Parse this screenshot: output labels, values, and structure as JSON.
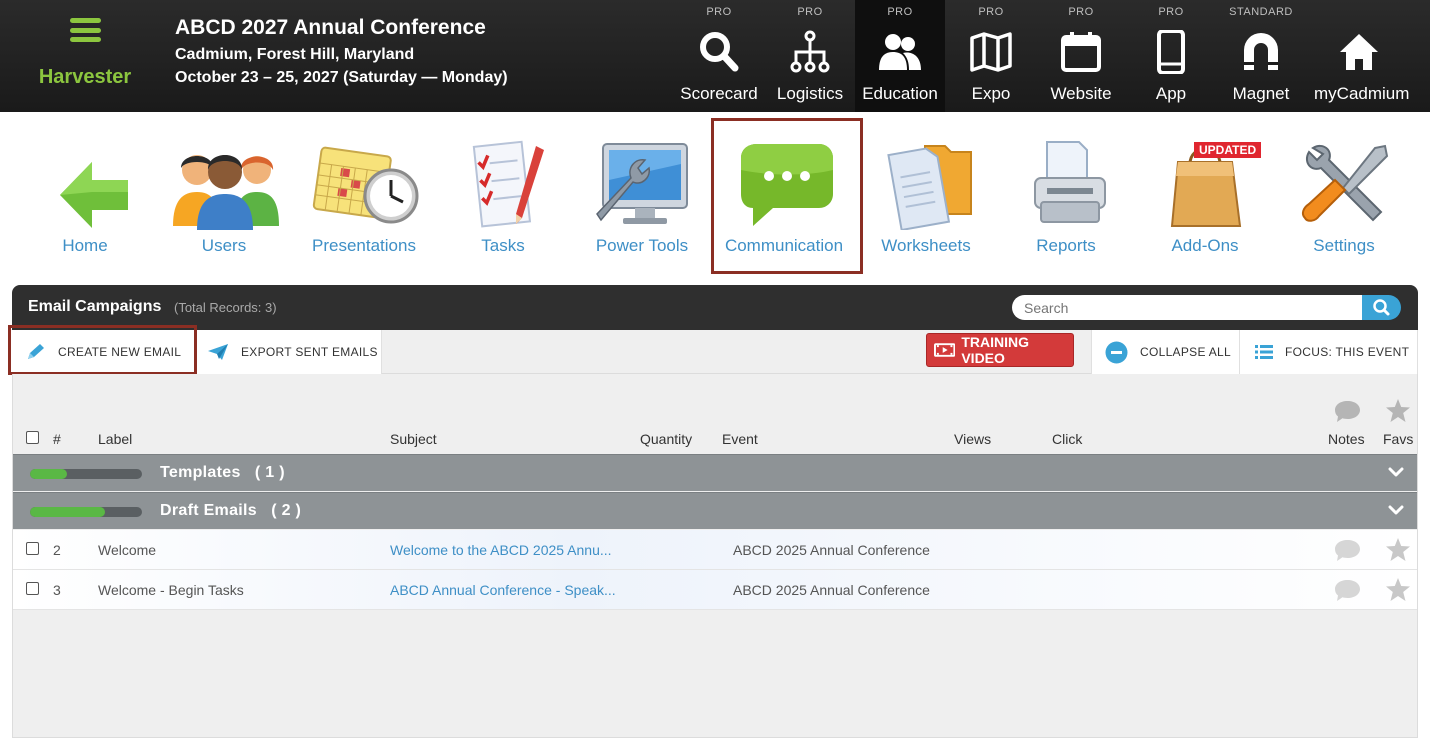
{
  "brand": {
    "name": "Harvester"
  },
  "event": {
    "title": "ABCD 2027 Annual Conference",
    "location": "Cadmium, Forest Hill, Maryland",
    "dates": "October 23 – 25, 2027 (Saturday — Monday)"
  },
  "topnav": [
    {
      "tier": "PRO",
      "label": "Scorecard",
      "icon": "search-icon"
    },
    {
      "tier": "PRO",
      "label": "Logistics",
      "icon": "org-chart-icon"
    },
    {
      "tier": "PRO",
      "label": "Education",
      "icon": "users-icon",
      "active": true
    },
    {
      "tier": "PRO",
      "label": "Expo",
      "icon": "map-icon"
    },
    {
      "tier": "PRO",
      "label": "Website",
      "icon": "calendar-icon"
    },
    {
      "tier": "PRO",
      "label": "App",
      "icon": "phone-icon"
    },
    {
      "tier": "STANDARD",
      "label": "Magnet",
      "icon": "magnet-icon"
    },
    {
      "tier": "",
      "label": "myCadmium",
      "icon": "home-icon"
    }
  ],
  "modules": [
    {
      "label": "Home",
      "icon": "back-arrow-icon"
    },
    {
      "label": "Users",
      "icon": "people-icon"
    },
    {
      "label": "Presentations",
      "icon": "calendar-clock-icon"
    },
    {
      "label": "Tasks",
      "icon": "checklist-icon"
    },
    {
      "label": "Power Tools",
      "icon": "monitor-wrench-icon"
    },
    {
      "label": "Communication",
      "icon": "chat-bubble-icon",
      "selected": true
    },
    {
      "label": "Worksheets",
      "icon": "folders-icon"
    },
    {
      "label": "Reports",
      "icon": "printer-icon"
    },
    {
      "label": "Add-Ons",
      "icon": "shopping-bag-icon",
      "badge": "UPDATED"
    },
    {
      "label": "Settings",
      "icon": "tools-icon"
    }
  ],
  "panel": {
    "title": "Email Campaigns",
    "count": "(Total Records: 3)",
    "search_placeholder": "Search"
  },
  "toolbar": {
    "create": "CREATE NEW EMAIL",
    "export": "EXPORT SENT EMAILS",
    "video": "TRAINING VIDEO",
    "collapse": "COLLAPSE ALL",
    "focus": "FOCUS: THIS EVENT"
  },
  "columns": {
    "num": "#",
    "label": "Label",
    "subject": "Subject",
    "quantity": "Quantity",
    "event": "Event",
    "views": "Views",
    "click": "Click",
    "notes": "Notes",
    "favs": "Favs"
  },
  "groups": [
    {
      "label": "Templates   ( 1 )",
      "progress": 0.33
    },
    {
      "label": "Draft Emails   ( 2 )",
      "progress": 0.67
    }
  ],
  "rows": [
    {
      "num": "2",
      "label": "Welcome",
      "subject": "Welcome to the ABCD 2025 Annu...",
      "event": "ABCD 2025 Annual Conference"
    },
    {
      "num": "3",
      "label": "Welcome - Begin Tasks",
      "subject": "ABCD Annual Conference - Speak...",
      "event": "ABCD 2025 Annual Conference"
    }
  ],
  "colors": {
    "brand_green": "#8cc63f",
    "link_blue": "#3e8fc6",
    "highlight": "#8b2e23",
    "video_red": "#d33a3a"
  }
}
